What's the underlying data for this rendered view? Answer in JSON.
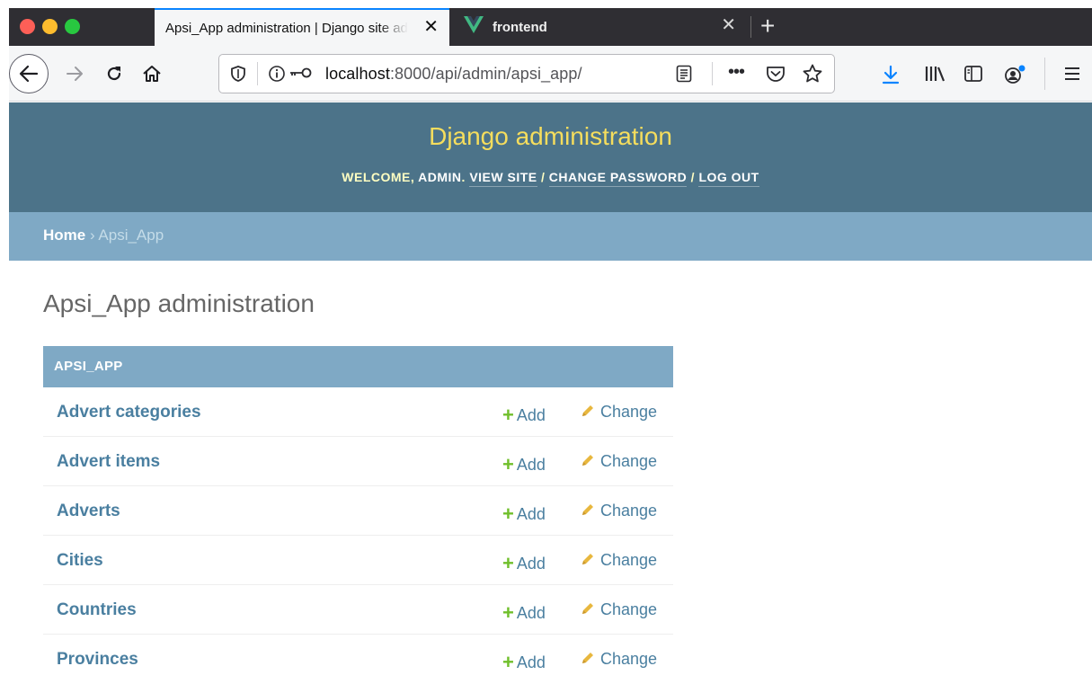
{
  "browser": {
    "tabs": [
      {
        "title": "Apsi_App administration | Django site admin",
        "active": true
      },
      {
        "title": "frontend",
        "active": false
      }
    ],
    "new_tab": "+",
    "close_glyph": "✕",
    "url_host": "localhost",
    "url_path": ":8000/api/admin/apsi_app/",
    "more_glyph": "•••",
    "icons": [
      "back-arrow-icon",
      "forward-arrow-icon",
      "reload-icon",
      "home-icon",
      "shield-icon",
      "info-icon",
      "key-icon",
      "reader-view-icon",
      "pocket-icon",
      "star-icon",
      "download-icon",
      "library-icon",
      "sidebar-icon",
      "account-icon",
      "hamburger-menu-icon"
    ],
    "colors": {
      "chrome_dark": "#2f2e33",
      "tab_active_accent": "#0a84ff",
      "download_blue": "#0a84ff"
    }
  },
  "admin": {
    "site_title": "Django administration",
    "user_tools": {
      "welcome": "WELCOME, ",
      "username": "ADMIN",
      "period": ". ",
      "view_site": "VIEW SITE",
      "sep1": " / ",
      "change_password": "CHANGE PASSWORD",
      "sep2": " / ",
      "log_out": "LOG OUT"
    },
    "breadcrumbs": {
      "home": "Home",
      "separator": " › ",
      "current": "Apsi_App"
    },
    "page_title": "Apsi_App administration",
    "module": {
      "caption": "APSI_APP",
      "add_label": "Add",
      "change_label": "Change",
      "models": [
        {
          "name": "Advert categories"
        },
        {
          "name": "Advert items"
        },
        {
          "name": "Adverts"
        },
        {
          "name": "Cities"
        },
        {
          "name": "Countries"
        },
        {
          "name": "Provinces"
        }
      ]
    },
    "colors": {
      "header_bg": "#4c7389",
      "site_title": "#f5dd5d",
      "breadcrumb_bg": "#7fa9c5",
      "link": "#4a7fa0",
      "add_plus": "#70bf2b",
      "change_pencil": "#e8b73e"
    }
  }
}
